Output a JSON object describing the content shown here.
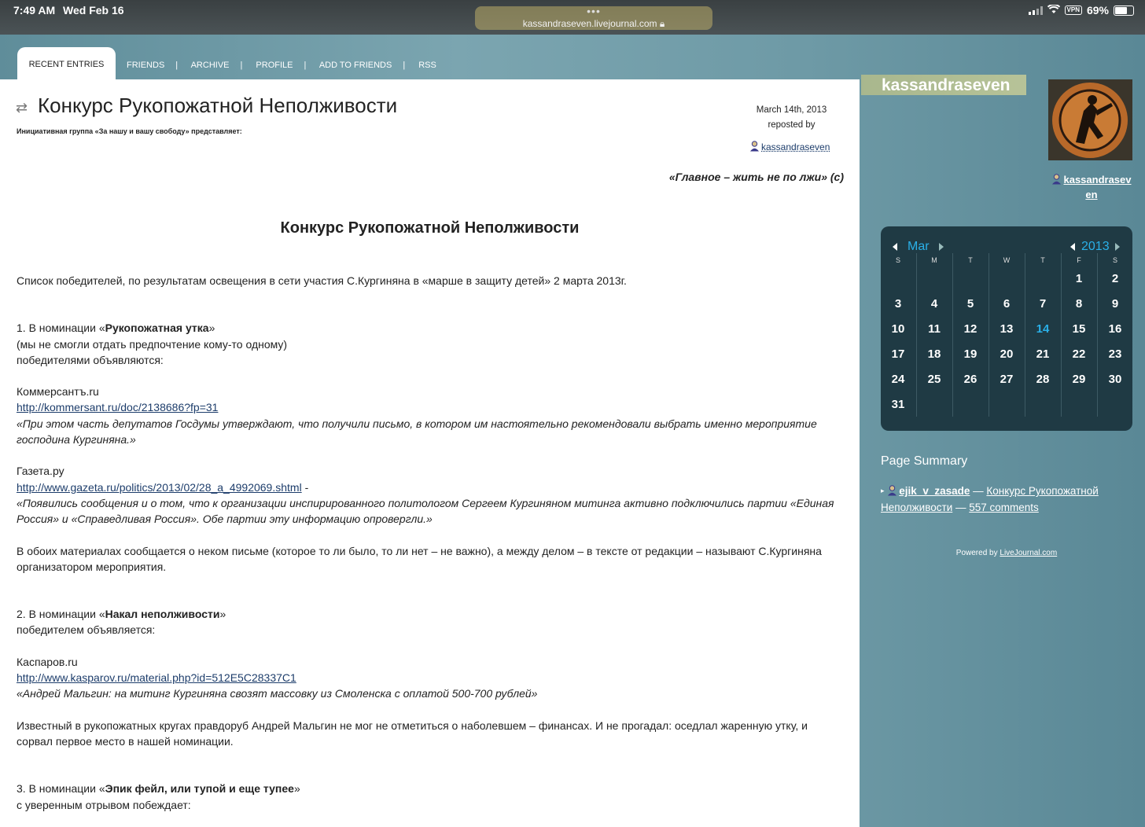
{
  "status_bar": {
    "time": "7:49 AM",
    "date": "Wed Feb 16",
    "url": "kassandraseven.livejournal.com",
    "vpn": "VPN",
    "battery": "69%"
  },
  "nav": {
    "active_tab": "RECENT ENTRIES",
    "links": [
      "FRIENDS",
      "ARCHIVE",
      "PROFILE",
      "ADD TO FRIENDS",
      "RSS"
    ],
    "separator": "|"
  },
  "entry": {
    "title": "Конкурс Рукопожатной Неполживости",
    "intro": "Инициативная группа «За нашу и вашу свободу» представляет:",
    "date": "March 14th, 2013",
    "reposted_label": "reposted by",
    "reposted_user": "kassandraseven",
    "quote": "«Главное – жить не по лжи» (с)",
    "subtitle": "Конкурс Рукопожатной Неполживости",
    "lead": "Список победителей, по результатам освещения в сети участия С.Кургиняна в «марше в защиту детей» 2 марта 2013г.",
    "n1_prefix": "1. В номинации «",
    "n1_name": "Рукопожатная утка",
    "n1_suffix": "»",
    "n1_line2": "(мы не смогли отдать предпочтение кому-то одному)",
    "n1_line3": "победителями объявляются:",
    "kommersant_name": "Коммерсантъ.ru",
    "kommersant_url": "http://kommersant.ru/doc/2138686?fp=31",
    "kommersant_quote": "«При этом часть депутатов Госдумы утверждают, что получили письмо, в котором им настоятельно рекомендовали выбрать именно мероприятие господина Кургиняна.»",
    "gazeta_name": "Газета.ру",
    "gazeta_url": "http://www.gazeta.ru/politics/2013/02/28_a_4992069.shtml",
    "gazeta_dash": " -",
    "gazeta_quote": "«Появились сообщения и о том, что к организации инспирированного политологом Сергеем Кургиняном митинга активно подключились партии «Единая Россия» и «Справедливая Россия». Обе партии эту информацию опровергли.»",
    "both_text": "В обоих материалах сообщается о неком письме (которое то ли было, то ли нет – не важно), а между делом – в тексте от редакции – называют С.Кургиняна организатором мероприятия.",
    "n2_prefix": "2. В номинации «",
    "n2_name": "Накал неполживости",
    "n2_suffix": "»",
    "n2_line2": "победителем объявляется:",
    "kasparov_name": "Каспаров.ru",
    "kasparov_url": "http://www.kasparov.ru/material.php?id=512E5C28337C1",
    "kasparov_quote": "«Андрей Мальгин: на митинг Кургиняна свозят массовку из Смоленска с оплатой 500-700 рублей»",
    "malgin_text": "Известный в рукопожатных кругах правдоруб Андрей Мальгин не мог не отметиться о наболевшем – финансах. И не прогадал: оседлал жаренную утку, и сорвал первое место в нашей номинации.",
    "n3_prefix": "3. В номинации «",
    "n3_name": "Эпик фейл, или тупой и еще тупее",
    "n3_suffix": "»",
    "n3_line2": "с уверенным отрывом побеждает:"
  },
  "sidebar": {
    "journal_name": "kassandraseven",
    "userpic_user": "kassandraseven",
    "calendar": {
      "month": "Mar",
      "year": "2013",
      "weekdays": [
        "S",
        "M",
        "T",
        "W",
        "T",
        "F",
        "S"
      ],
      "highlight_day": 14,
      "first_weekday": 5,
      "days_in_month": 31
    },
    "summary_title": "Page Summary",
    "summary_user": "ejik_v_zasade",
    "summary_dash1": "—",
    "summary_entry": "Конкурс Рукопожатной Неполживости",
    "summary_dash2": "—",
    "summary_comments": "557 comments",
    "powered_prefix": "Powered by ",
    "powered_link": "LiveJournal.com"
  },
  "colors": {
    "accent": "#2ab0e8",
    "calendar_bg": "#1f3a44",
    "page_bg": "#6e9aa6"
  }
}
